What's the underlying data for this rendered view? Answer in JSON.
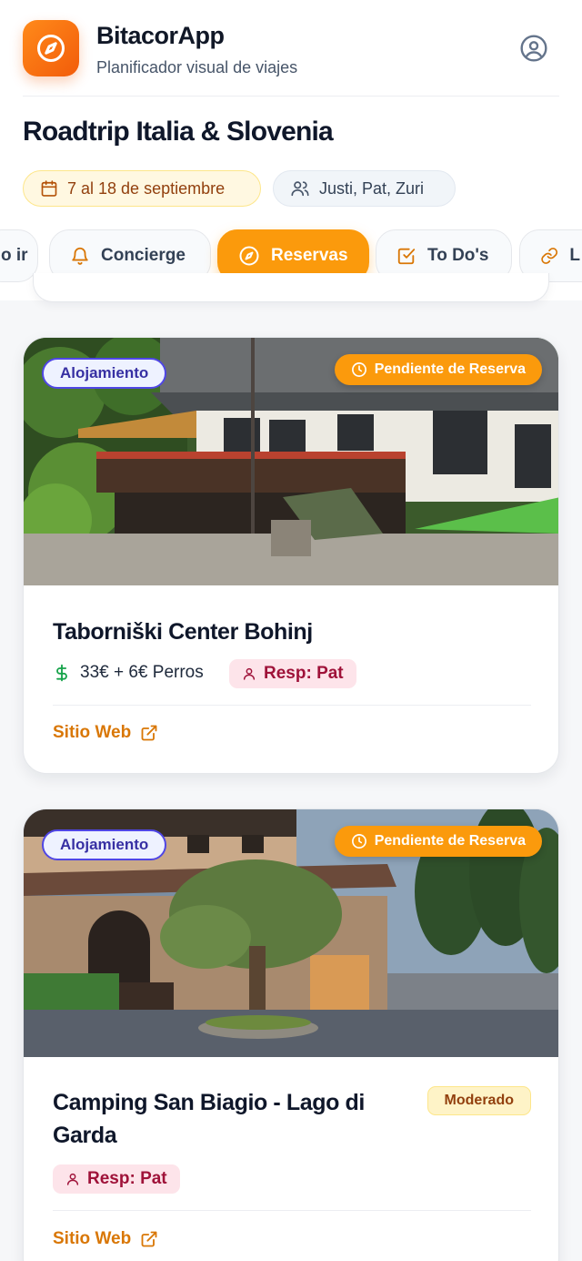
{
  "app": {
    "title": "BitacorApp",
    "subtitle": "Planificador visual de viajes",
    "accent": "#fb9a0c"
  },
  "trip": {
    "title": "Roadtrip Italia & Slovenia",
    "dates": "7 al 18 de septiembre",
    "people": "Justi, Pat, Zuri"
  },
  "tabs": [
    {
      "label": "Qué ir",
      "icon": "map-icon",
      "active": false
    },
    {
      "label": "Concierge",
      "icon": "bell-icon",
      "active": false
    },
    {
      "label": "Reservas",
      "icon": "compass-icon",
      "active": true
    },
    {
      "label": "To Do's",
      "icon": "checkbox-icon",
      "active": false
    },
    {
      "label": "Links",
      "icon": "link-icon",
      "active": false
    }
  ],
  "tab_partial_left": "o ir",
  "tab_partial_right": "L",
  "cards": [
    {
      "type": "Alojamiento",
      "status": "Pendiente de Reserva",
      "title": "Taborniški Center Bohinj",
      "price": "33€ + 6€ Perros",
      "responsible": "Resp: Pat",
      "link": "Sitio Web"
    },
    {
      "type": "Alojamiento",
      "status": "Pendiente de Reserva",
      "title_line1": "Camping San Biagio - Lago di",
      "title_line2": "Garda",
      "level": "Moderado",
      "responsible": "Resp: Pat",
      "link": "Sitio Web"
    }
  ]
}
